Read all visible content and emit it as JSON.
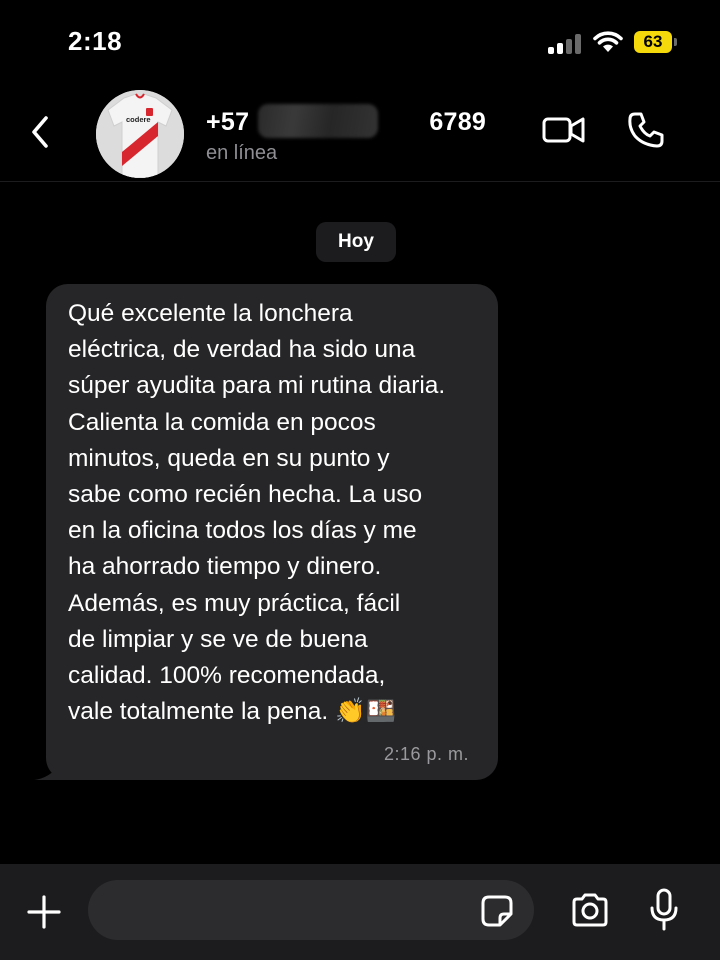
{
  "status_bar": {
    "time": "2:18",
    "battery": "63",
    "icons": [
      "signal-icon",
      "wifi-icon",
      "battery-icon"
    ],
    "battery_color": "#f5d90a"
  },
  "header": {
    "contact_number_prefix": "+57",
    "contact_number_suffix": "6789",
    "contact_status": "en línea",
    "avatar_text": "codere",
    "icons": [
      "back-icon",
      "video-call-icon",
      "phone-icon"
    ]
  },
  "chat": {
    "date_label": "Hoy",
    "messages": [
      {
        "direction": "incoming",
        "text": "Qué excelente la lonchera\neléctrica, de verdad ha sido una\nsúper ayudita para mi rutina diaria.\nCalienta la comida en pocos\nminutos, queda en su punto y\nsabe como recién hecha. La uso\nen la oficina todos los días y me\nha ahorrado tiempo y dinero.\nAdemás,  es muy práctica, fácil\nde limpiar y se ve de buena\ncalidad.  100% recomendada,\nvale totalmente la pena. 👏🍱",
        "time": "2:16 p. m."
      }
    ]
  },
  "composer": {
    "value": "",
    "icons": [
      "plus-icon",
      "sticker-icon",
      "camera-icon",
      "microphone-icon"
    ]
  },
  "colors": {
    "background": "#000000",
    "bubble": "#262628",
    "secondary_text": "#8e8e93",
    "input_bar": "#1c1c1e"
  }
}
